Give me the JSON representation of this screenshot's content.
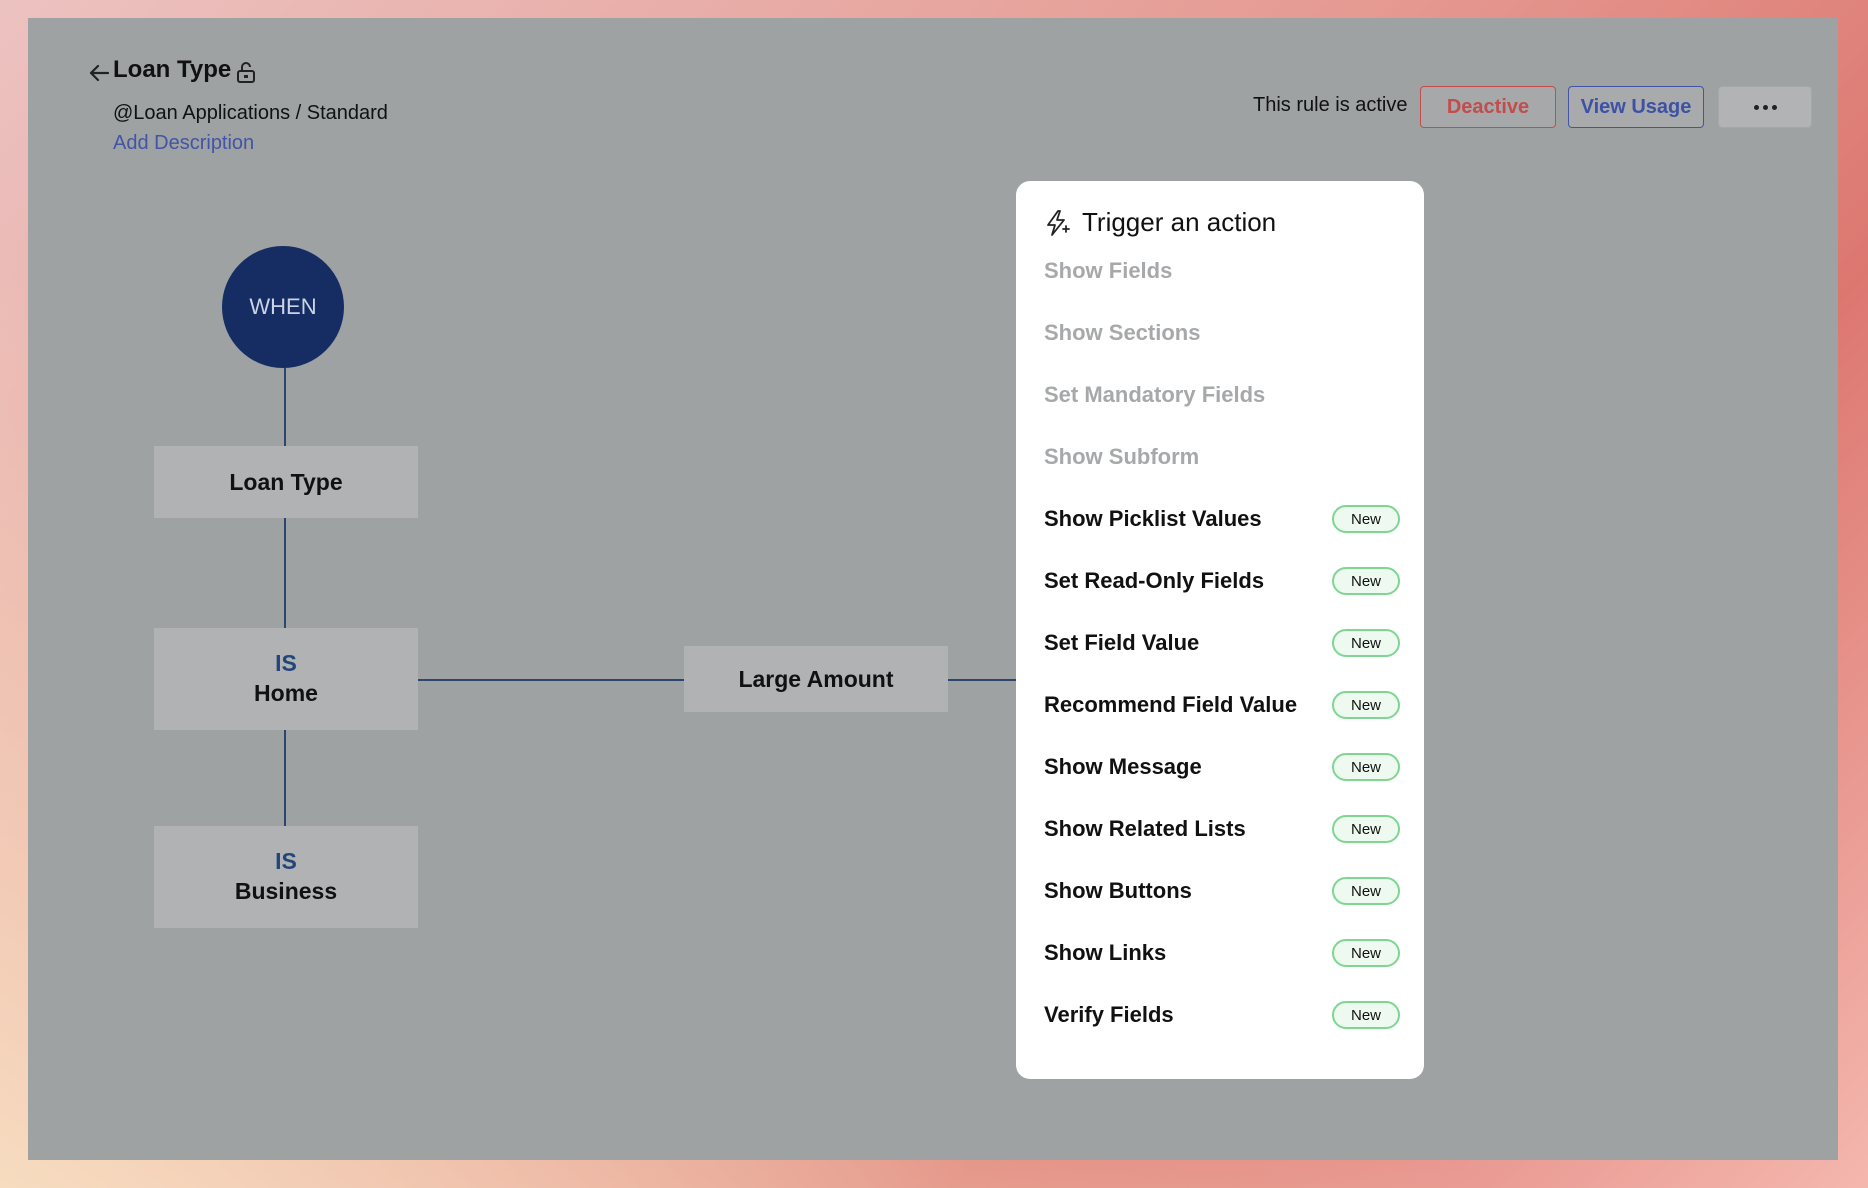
{
  "header": {
    "title": "Loan Type",
    "breadcrumb": "@Loan Applications / Standard",
    "add_description": "Add Description",
    "status_text": "This rule is active",
    "deactive_label": "Deactive",
    "view_usage_label": "View Usage"
  },
  "flow": {
    "when_label": "WHEN",
    "field_node": "Loan Type",
    "conditions": [
      {
        "operator": "IS",
        "value": "Home"
      },
      {
        "operator": "IS",
        "value": "Business"
      }
    ],
    "result_node": "Large Amount"
  },
  "action_menu": {
    "title": "Trigger an action",
    "badge_label": "New",
    "items": [
      {
        "label": "Show Fields",
        "enabled": false,
        "is_new": false
      },
      {
        "label": "Show Sections",
        "enabled": false,
        "is_new": false
      },
      {
        "label": "Set Mandatory Fields",
        "enabled": false,
        "is_new": false
      },
      {
        "label": "Show Subform",
        "enabled": false,
        "is_new": false
      },
      {
        "label": "Show Picklist Values",
        "enabled": true,
        "is_new": true
      },
      {
        "label": "Set Read-Only Fields",
        "enabled": true,
        "is_new": true
      },
      {
        "label": "Set Field Value",
        "enabled": true,
        "is_new": true
      },
      {
        "label": "Recommend Field Value",
        "enabled": true,
        "is_new": true
      },
      {
        "label": "Show Message",
        "enabled": true,
        "is_new": true
      },
      {
        "label": "Show Related Lists",
        "enabled": true,
        "is_new": true
      },
      {
        "label": "Show Buttons",
        "enabled": true,
        "is_new": true
      },
      {
        "label": "Show Links",
        "enabled": true,
        "is_new": true
      },
      {
        "label": "Verify Fields",
        "enabled": true,
        "is_new": true
      }
    ]
  },
  "icons": {
    "back": "arrow-left-icon",
    "lock": "lock-icon",
    "more": "more-horizontal-icon",
    "trigger": "lightning-bolt-icon"
  },
  "colors": {
    "when_circle": "#162d63",
    "connector": "#2d4670",
    "deactive": "#c34d4d",
    "view_usage": "#4254a6",
    "new_badge_border": "#7ed692"
  }
}
